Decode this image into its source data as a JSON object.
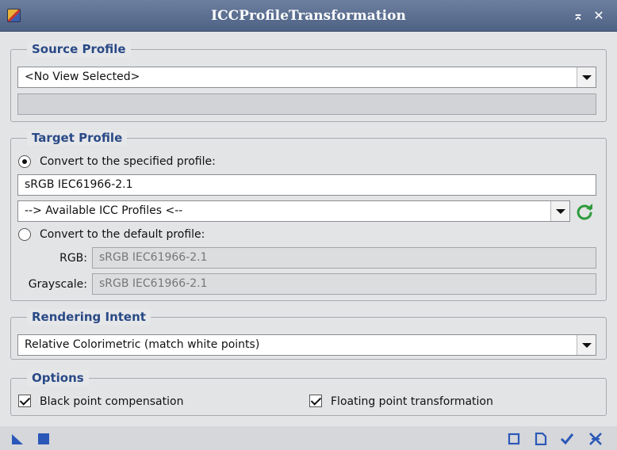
{
  "window": {
    "title": "ICCProfileTransformation",
    "pin_glyph": "⌅",
    "close_glyph": "✕"
  },
  "source_profile": {
    "legend": "Source Profile",
    "view_select": "<No View Selected>",
    "profile_info": ""
  },
  "target_profile": {
    "legend": "Target Profile",
    "convert_specified_label": "Convert to the specified profile:",
    "convert_specified_checked": true,
    "specified_profile": "sRGB IEC61966-2.1",
    "available_profiles": "--> Available ICC Profiles <--",
    "convert_default_label": "Convert to the default profile:",
    "convert_default_checked": false,
    "rgb_label": "RGB:",
    "rgb_value": "sRGB IEC61966-2.1",
    "grayscale_label": "Grayscale:",
    "grayscale_value": "sRGB IEC61966-2.1"
  },
  "rendering_intent": {
    "legend": "Rendering Intent",
    "selected": "Relative Colorimetric (match white points)"
  },
  "options": {
    "legend": "Options",
    "black_point_label": "Black point compensation",
    "black_point_checked": true,
    "floating_point_label": "Floating point transformation",
    "floating_point_checked": true
  },
  "colors": {
    "title_bar": "#5b6e91",
    "legend_text": "#2a4a86",
    "refresh_icon": "#2e9a3a",
    "bottom_icons": "#2b58b8"
  },
  "icons": {
    "new_instance": "new-instance-icon",
    "apply_global": "apply-global-icon",
    "new_window": "new-window-icon",
    "documentation": "documentation-icon",
    "apply": "apply-icon",
    "reset": "reset-icon",
    "refresh": "refresh-icon"
  }
}
